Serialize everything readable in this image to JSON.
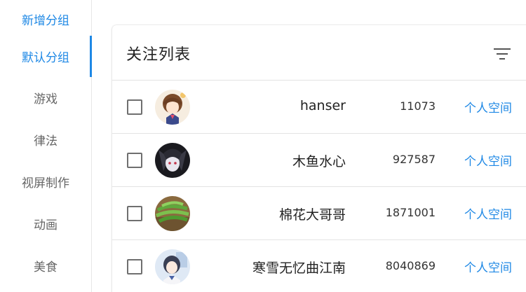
{
  "sidebar": {
    "items": [
      {
        "label": "新增分组"
      },
      {
        "label": "默认分组"
      },
      {
        "label": "游戏"
      },
      {
        "label": "律法"
      },
      {
        "label": "视屏制作"
      },
      {
        "label": "动画"
      },
      {
        "label": "美食"
      }
    ]
  },
  "card": {
    "title": "关注列表",
    "filter_icon": "filter-list-icon"
  },
  "rows": [
    {
      "name": "hanser",
      "count": "11073",
      "link": "个人空间"
    },
    {
      "name": "木鱼水心",
      "count": "927587",
      "link": "个人空间"
    },
    {
      "name": "棉花大哥哥",
      "count": "1871001",
      "link": "个人空间"
    },
    {
      "name": "寒雪无忆曲江南",
      "count": "8040869",
      "link": "个人空间"
    }
  ],
  "colors": {
    "accent": "#1e88e5",
    "text": "#222222",
    "muted": "#666666"
  }
}
